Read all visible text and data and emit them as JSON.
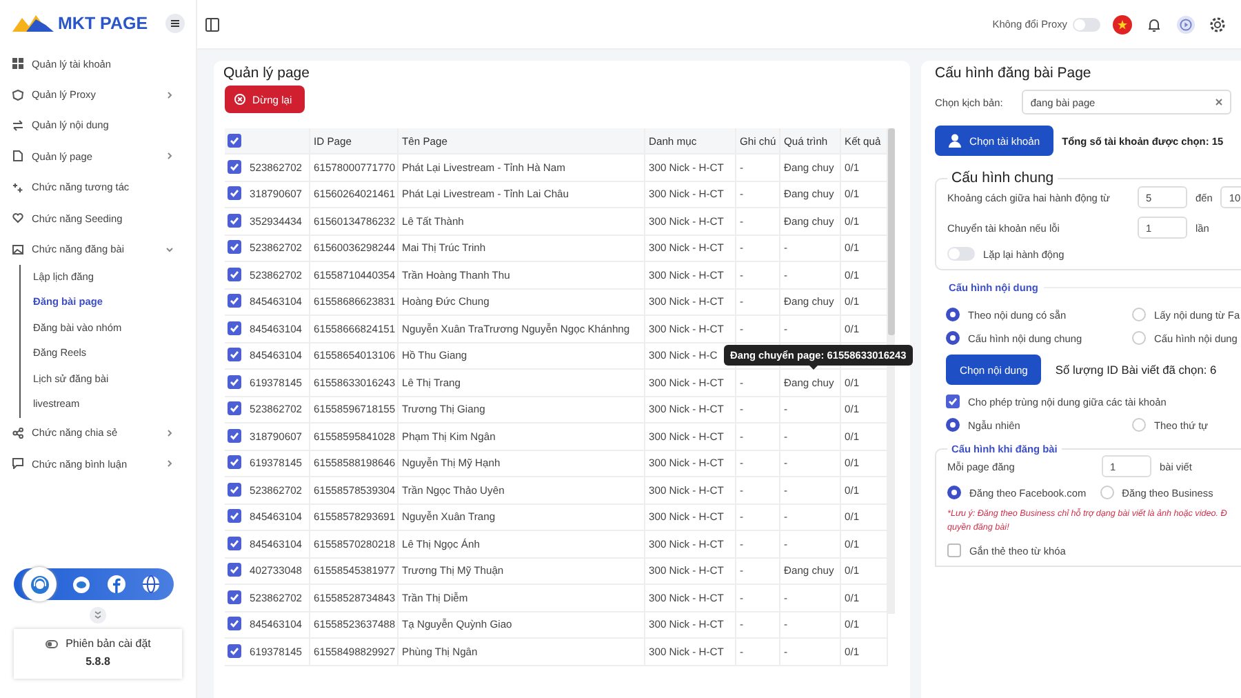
{
  "sidebar": {
    "logo": "MKT PAGE",
    "items": [
      {
        "kind": "link",
        "label": "Quản lý tài khoản"
      },
      {
        "kind": "group",
        "label": "Quản lý Proxy",
        "expanded": false
      },
      {
        "kind": "link",
        "label": "Quản lý nội dung"
      },
      {
        "kind": "group",
        "label": "Quản lý page",
        "expanded": false
      },
      {
        "kind": "link",
        "label": "Chức năng tương tác"
      },
      {
        "kind": "link",
        "label": "Chức năng Seeding"
      },
      {
        "kind": "group",
        "label": "Chức năng đăng bài",
        "expanded": true,
        "children": [
          {
            "label": "Lập lịch đăng",
            "selected": false
          },
          {
            "label": "Đăng bài page",
            "selected": true
          },
          {
            "label": "Đăng bài vào nhóm",
            "selected": false
          },
          {
            "label": "Đăng Reels",
            "selected": false
          },
          {
            "label": "Lịch sử đăng bài",
            "selected": false
          },
          {
            "label": "livestream",
            "selected": false
          }
        ]
      },
      {
        "kind": "group",
        "label": "Chức năng chia sẻ",
        "expanded": false
      },
      {
        "kind": "group",
        "label": "Chức năng bình luận",
        "expanded": false
      }
    ],
    "version": {
      "label": "Phiên bản cài đặt",
      "value": "5.8.8"
    }
  },
  "topbar": {
    "proxy_label": "Không đổi Proxy",
    "proxy_on": false
  },
  "page": {
    "title": "Quản lý page",
    "stop_button": "Dừng lại",
    "table": {
      "all_selected": true,
      "columns": [
        "ID Page",
        "Tên Page",
        "Danh mục",
        "Ghi chú",
        "Quá trình",
        "Kết quả"
      ],
      "rows": [
        {
          "selected": true,
          "column_2": "523862702",
          "id_page": "61578000771770",
          "ten_page": "Phát Lại Livestream - Tỉnh Hà Nam",
          "danh_muc": "300 Nick - H-CT",
          "ghi_chu": "-",
          "qua_trinh": "Đang chuy",
          "ket_qua": "0/1"
        },
        {
          "selected": true,
          "column_2": "318790607",
          "id_page": "61560264021461",
          "ten_page": "Phát Lại Livestream - Tỉnh Lai Châu",
          "danh_muc": "300 Nick - H-CT",
          "ghi_chu": "-",
          "qua_trinh": "Đang chuy",
          "ket_qua": "0/1"
        },
        {
          "selected": true,
          "column_2": "352934434",
          "id_page": "61560134786232",
          "ten_page": "Lê Tất Thành",
          "danh_muc": "300 Nick - H-CT",
          "ghi_chu": "-",
          "qua_trinh": "Đang chuy",
          "ket_qua": "0/1"
        },
        {
          "selected": true,
          "column_2": "523862702",
          "id_page": "61560036298244",
          "ten_page": "Mai Thị Trúc Trinh",
          "danh_muc": "300 Nick - H-CT",
          "ghi_chu": "-",
          "qua_trinh": "-",
          "ket_qua": "0/1"
        },
        {
          "selected": true,
          "column_2": "523862702",
          "id_page": "61558710440354",
          "ten_page": "Trần Hoàng Thanh Thu",
          "danh_muc": "300 Nick - H-CT",
          "ghi_chu": "-",
          "qua_trinh": "-",
          "ket_qua": "0/1"
        },
        {
          "selected": true,
          "column_2": "845463104",
          "id_page": "61558686623831",
          "ten_page": "Hoàng Đức Chung",
          "danh_muc": "300 Nick - H-CT",
          "ghi_chu": "-",
          "qua_trinh": "Đang chuy",
          "ket_qua": "0/1"
        },
        {
          "selected": true,
          "column_2": "845463104",
          "id_page": "61558666824151",
          "ten_page": "Nguyễn Xuân TraTrương Nguyễn Ngọc Khánhng",
          "danh_muc": "300 Nick - H-CT",
          "ghi_chu": "-",
          "qua_trinh": "-",
          "ket_qua": "0/1"
        },
        {
          "selected": true,
          "column_2": "845463104",
          "id_page": "61558654013106",
          "ten_page": "Hồ Thu Giang",
          "danh_muc": "300 Nick - H-C",
          "tooltip": "Đang chuyển page: 61558633016243"
        },
        {
          "selected": true,
          "column_2": "619378145",
          "id_page": "61558633016243",
          "ten_page": "Lê Thị Trang",
          "danh_muc": "300 Nick - H-CT",
          "ghi_chu": "-",
          "qua_trinh": "Đang chuy",
          "ket_qua": "0/1"
        },
        {
          "selected": true,
          "column_2": "523862702",
          "id_page": "61558596718155",
          "ten_page": "Trương Thị Giang",
          "danh_muc": "300 Nick - H-CT",
          "ghi_chu": "-",
          "qua_trinh": "-",
          "ket_qua": "0/1"
        },
        {
          "selected": true,
          "column_2": "318790607",
          "id_page": "61558595841028",
          "ten_page": "Phạm Thị Kim Ngân",
          "danh_muc": "300 Nick - H-CT",
          "ghi_chu": "-",
          "qua_trinh": "-",
          "ket_qua": "0/1"
        },
        {
          "selected": true,
          "column_2": "619378145",
          "id_page": "61558588198646",
          "ten_page": "Nguyễn Thị Mỹ Hạnh",
          "danh_muc": "300 Nick - H-CT",
          "ghi_chu": "-",
          "qua_trinh": "-",
          "ket_qua": "0/1"
        },
        {
          "selected": true,
          "column_2": "523862702",
          "id_page": "61558578539304",
          "ten_page": "Trần Ngọc Thảo Uyên",
          "danh_muc": "300 Nick - H-CT",
          "ghi_chu": "-",
          "qua_trinh": "-",
          "ket_qua": "0/1"
        },
        {
          "selected": true,
          "column_2": "845463104",
          "id_page": "61558578293691",
          "ten_page": "Nguyễn Xuân Trang",
          "danh_muc": "300 Nick - H-CT",
          "ghi_chu": "-",
          "qua_trinh": "-",
          "ket_qua": "0/1"
        },
        {
          "selected": true,
          "column_2": "845463104",
          "id_page": "61558570280218",
          "ten_page": "Lê Thị Ngọc Ánh",
          "danh_muc": "300 Nick - H-CT",
          "ghi_chu": "-",
          "qua_trinh": "-",
          "ket_qua": "0/1"
        },
        {
          "selected": true,
          "column_2": "402733048",
          "id_page": "61558545381977",
          "ten_page": "Trương Thị Mỹ Thuận",
          "danh_muc": "300 Nick - H-CT",
          "ghi_chu": "-",
          "qua_trinh": "Đang chuy",
          "ket_qua": "0/1"
        },
        {
          "selected": true,
          "column_2": "523862702",
          "id_page": "61558528734843",
          "ten_page": "Trần Thị Diễm",
          "danh_muc": "300 Nick - H-CT",
          "ghi_chu": "-",
          "qua_trinh": "-",
          "ket_qua": "0/1"
        },
        {
          "selected": true,
          "column_2": "845463104",
          "id_page": "61558523637488",
          "ten_page": "Tạ Nguyễn Quỳnh Giao",
          "danh_muc": "300 Nick - H-CT",
          "ghi_chu": "-",
          "qua_trinh": "-",
          "ket_qua": "0/1"
        },
        {
          "selected": true,
          "column_2": "619378145",
          "id_page": "61558498829927",
          "ten_page": "Phùng Thị Ngân",
          "danh_muc": "300 Nick - H-CT",
          "ghi_chu": "-",
          "qua_trinh": "-",
          "ket_qua": "0/1"
        }
      ]
    }
  },
  "config": {
    "title": "Cấu hình đăng bài Page",
    "script_label": "Chọn kịch bản:",
    "script_value": "đang bài page",
    "account_button": "Chọn tài khoản",
    "account_count": "Tổng số tài khoản được chọn: 15",
    "general": {
      "title": "Cấu hình chung",
      "delay_label": "Khoảng cách giữa hai hành động từ",
      "delay_from": "5",
      "delay_to_label": "đến",
      "delay_to": "10",
      "switch_label": "Chuyển tài khoản nếu lỗi",
      "switch_value": "1",
      "switch_unit": "lần",
      "repeat_label": "Lặp lại hành động",
      "repeat_on": false
    },
    "content": {
      "title": "Cấu hình nội dung",
      "radio_rows": [
        [
          {
            "label": "Theo nội dung có sẵn",
            "selected": true
          },
          {
            "label": "Lấy nội dung từ Fa",
            "selected": false
          }
        ],
        [
          {
            "label": "Cấu hình nội dung chung",
            "selected": true
          },
          {
            "label": "Cấu hình nội dung",
            "selected": false
          }
        ]
      ],
      "button": "Chọn nội dung",
      "count": "Số lượng ID Bài viết đã chọn: 6",
      "allow_label": "Cho phép trùng nội dung giữa các tài khoản",
      "allow_checked": true,
      "order": [
        {
          "label": "Ngẫu nhiên",
          "selected": true
        },
        {
          "label": "Theo thứ tự",
          "selected": false
        }
      ]
    },
    "posting": {
      "title": "Cấu hình khi đăng bài",
      "per_page_label": "Mỗi page đăng",
      "per_page_value": "1",
      "per_page_unit": "bài viết",
      "mode": [
        {
          "label": "Đăng theo Facebook.com",
          "selected": true
        },
        {
          "label": "Đăng theo Business",
          "selected": false
        }
      ],
      "note_lines": [
        "*Lưu ý: Đăng theo Business chỉ hỗ trợ dạng bài viết là ảnh hoặc video. Đ",
        "quyền đăng bài!"
      ],
      "tag_label": "Gắn thẻ theo từ khóa",
      "tag_checked": false
    }
  }
}
